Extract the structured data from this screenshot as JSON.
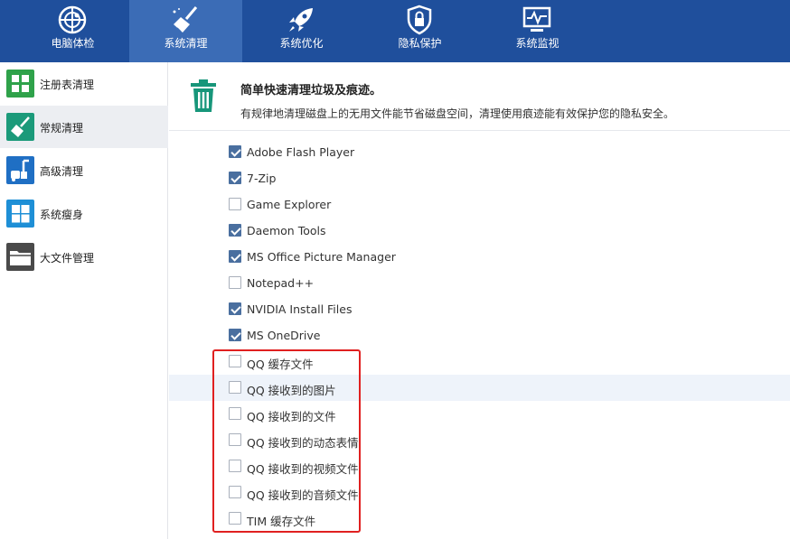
{
  "tabs": [
    {
      "label": "电脑体检",
      "icon": "radar-icon",
      "active": false
    },
    {
      "label": "系统清理",
      "icon": "broom-icon",
      "active": true
    },
    {
      "label": "系统优化",
      "icon": "rocket-icon",
      "active": false
    },
    {
      "label": "隐私保护",
      "icon": "shield-lock-icon",
      "active": false
    },
    {
      "label": "系统监视",
      "icon": "monitor-icon",
      "active": false
    }
  ],
  "sidebar": {
    "items": [
      {
        "label": "注册表清理",
        "icon": "registry-icon",
        "color": "#2fa24a",
        "active": false
      },
      {
        "label": "常规清理",
        "icon": "broom-icon",
        "color": "#1b9a7a",
        "active": true
      },
      {
        "label": "高级清理",
        "icon": "vacuum-icon",
        "color": "#1f6fc4",
        "active": false
      },
      {
        "label": "系统瘦身",
        "icon": "windows-icon",
        "color": "#1e8fd6",
        "active": false
      },
      {
        "label": "大文件管理",
        "icon": "folder-icon",
        "color": "#4a4a4a",
        "active": false
      }
    ]
  },
  "header": {
    "title": "简单快速清理垃圾及痕迹。",
    "desc": "有规律地清理磁盘上的无用文件能节省磁盘空间，清理使用痕迹能有效保护您的隐私安全。",
    "icon": "trash-icon"
  },
  "list": {
    "items": [
      {
        "label": "Adobe Flash Player",
        "checked": true
      },
      {
        "label": "7-Zip",
        "checked": true
      },
      {
        "label": "Game Explorer",
        "checked": false
      },
      {
        "label": "Daemon Tools",
        "checked": true
      },
      {
        "label": "MS Office Picture Manager",
        "checked": true
      },
      {
        "label": "Notepad++",
        "checked": false
      },
      {
        "label": "NVIDIA Install Files",
        "checked": true
      },
      {
        "label": "MS OneDrive",
        "checked": true
      },
      {
        "label": "QQ 缓存文件",
        "checked": false
      },
      {
        "label": "QQ 接收到的图片",
        "checked": false
      },
      {
        "label": "QQ 接收到的文件",
        "checked": false
      },
      {
        "label": "QQ 接收到的动态表情",
        "checked": false
      },
      {
        "label": "QQ 接收到的视频文件",
        "checked": false
      },
      {
        "label": "QQ 接收到的音频文件",
        "checked": false
      },
      {
        "label": "TIM 缓存文件",
        "checked": false
      }
    ]
  },
  "colors": {
    "topbar": "#1f4f9c",
    "active_tab": "#3b6cb6",
    "highlight_box": "#e02020",
    "checkbox_on": "#4a6f9f"
  }
}
